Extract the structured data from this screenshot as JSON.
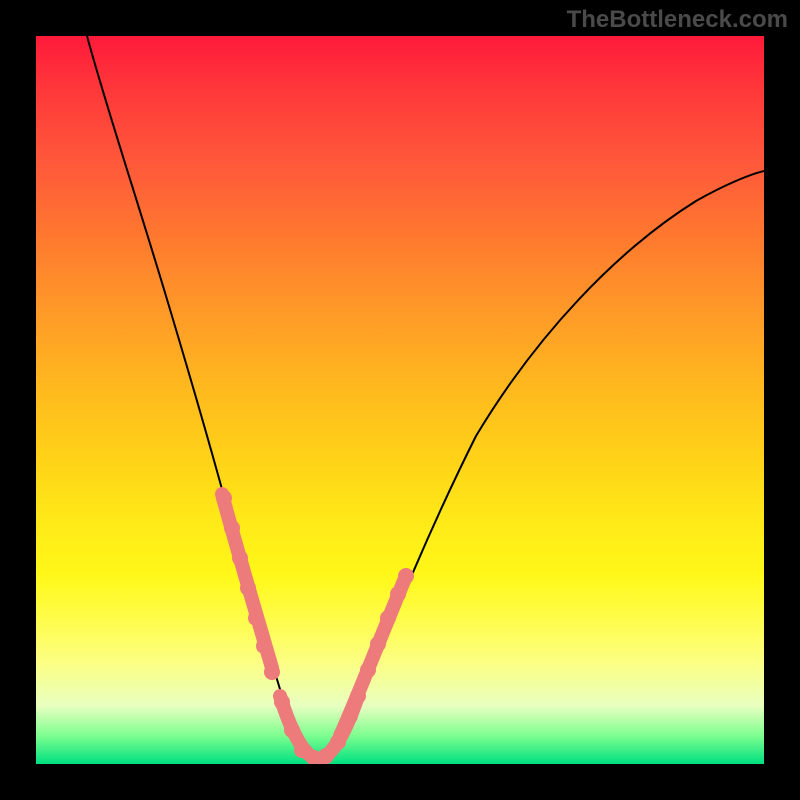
{
  "watermark": "TheBottleneck.com",
  "chart_data": {
    "type": "line",
    "title": "",
    "xlabel": "",
    "ylabel": "",
    "xlim": [
      0,
      100
    ],
    "ylim": [
      0,
      100
    ],
    "grid": false,
    "legend": false,
    "description": "Bottleneck curve: V-shaped profile on a red-to-green vertical gradient background. Minimum near x≈37 at y≈1. Pink marker bands highlight segments near the minimum on both sides.",
    "series": [
      {
        "name": "bottleneck-curve",
        "x": [
          7,
          10,
          14,
          18,
          22,
          25,
          27,
          29,
          31,
          33,
          34,
          35,
          36,
          37,
          38,
          39,
          40,
          41,
          43,
          46,
          50,
          55,
          60,
          66,
          74,
          82,
          90,
          100
        ],
        "y": [
          100,
          89,
          77,
          65,
          52,
          42,
          35,
          28,
          21,
          14,
          10,
          6,
          4,
          1,
          1,
          1,
          2,
          4,
          8,
          14,
          22,
          30,
          39,
          47,
          57,
          65,
          72,
          80
        ]
      }
    ],
    "highlight_bands": [
      {
        "side": "left",
        "x_range": [
          25,
          31
        ],
        "note": "pink marker band on descending arm"
      },
      {
        "side": "floor",
        "x_range": [
          33,
          41
        ],
        "note": "pink marker band across minimum"
      },
      {
        "side": "right",
        "x_range": [
          41,
          49
        ],
        "note": "pink marker band on ascending arm"
      }
    ],
    "background_gradient": {
      "orientation": "vertical",
      "stops": [
        {
          "pos": 0.0,
          "color": "#ff1a3a"
        },
        {
          "pos": 0.5,
          "color": "#ffd218"
        },
        {
          "pos": 0.82,
          "color": "#fffc4a"
        },
        {
          "pos": 1.0,
          "color": "#00e080"
        }
      ]
    }
  }
}
